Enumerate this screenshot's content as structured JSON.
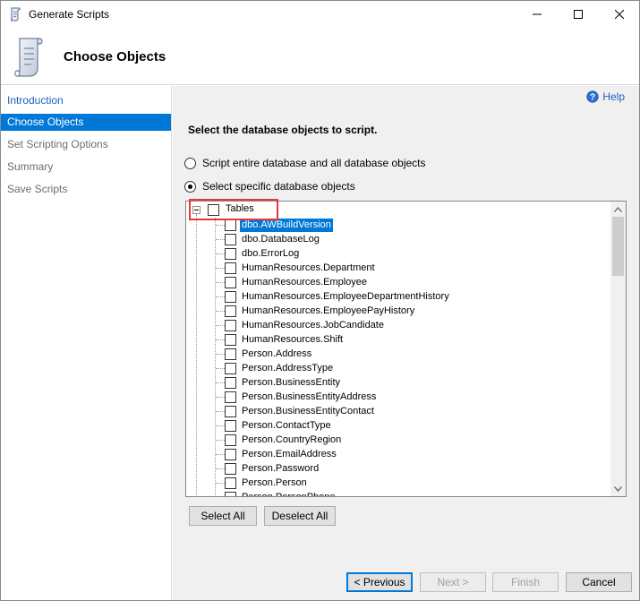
{
  "window": {
    "title": "Generate Scripts",
    "minimize_icon": "minimize-icon",
    "maximize_icon": "maximize-icon",
    "close_icon": "close-icon"
  },
  "header": {
    "title": "Choose Objects",
    "icon": "script-scroll-icon"
  },
  "nav": {
    "items": [
      {
        "label": "Introduction",
        "state": "link"
      },
      {
        "label": "Choose Objects",
        "state": "active"
      },
      {
        "label": "Set Scripting Options",
        "state": "disabled"
      },
      {
        "label": "Summary",
        "state": "disabled"
      },
      {
        "label": "Save Scripts",
        "state": "disabled"
      }
    ]
  },
  "content": {
    "help_label": "Help",
    "help_icon": "help-icon",
    "instruction": "Select the database objects to script.",
    "options": [
      {
        "label": "Script entire database and all database objects",
        "selected": false
      },
      {
        "label": "Select specific database objects",
        "selected": true
      }
    ],
    "tree": {
      "root_label": "Tables",
      "root_checked": false,
      "items": [
        "dbo.AWBuildVersion",
        "dbo.DatabaseLog",
        "dbo.ErrorLog",
        "HumanResources.Department",
        "HumanResources.Employee",
        "HumanResources.EmployeeDepartmentHistory",
        "HumanResources.EmployeePayHistory",
        "HumanResources.JobCandidate",
        "HumanResources.Shift",
        "Person.Address",
        "Person.AddressType",
        "Person.BusinessEntity",
        "Person.BusinessEntityAddress",
        "Person.BusinessEntityContact",
        "Person.ContactType",
        "Person.CountryRegion",
        "Person.EmailAddress",
        "Person.Password",
        "Person.Person",
        "Person.PersonPhone"
      ],
      "selected_item": "dbo.AWBuildVersion"
    },
    "select_all_label": "Select All",
    "deselect_all_label": "Deselect All"
  },
  "footer": {
    "previous_label": "< Previous",
    "next_label": "Next >",
    "finish_label": "Finish",
    "cancel_label": "Cancel"
  },
  "colors": {
    "accent": "#0078d7",
    "link": "#1f5fbf",
    "highlight_box": "#e53935",
    "panel_bg": "#f0f0f0"
  }
}
